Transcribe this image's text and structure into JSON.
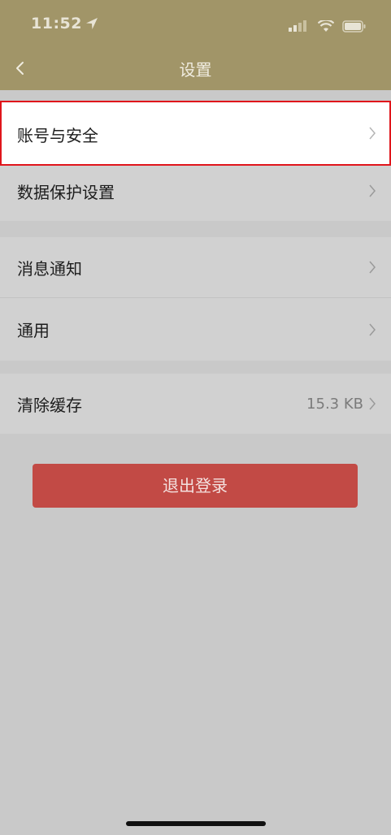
{
  "status_bar": {
    "time": "11:52"
  },
  "nav": {
    "title": "设置"
  },
  "settings": {
    "account_security": "账号与安全",
    "data_protection": "数据保护设置",
    "notifications": "消息通知",
    "general": "通用",
    "clear_cache": "清除缓存",
    "cache_size": "15.3 KB"
  },
  "logout": {
    "label": "退出登录"
  },
  "colors": {
    "header": "#a19568",
    "background": "#c9c9c9",
    "highlight_border": "#e0151b",
    "logout_button": "#c24a45"
  },
  "icons": {
    "back": "chevron-left-icon",
    "row_arrow": "chevron-right-icon",
    "location": "location-arrow-icon",
    "signal": "cellular-signal-icon",
    "wifi": "wifi-icon",
    "battery": "battery-icon"
  }
}
